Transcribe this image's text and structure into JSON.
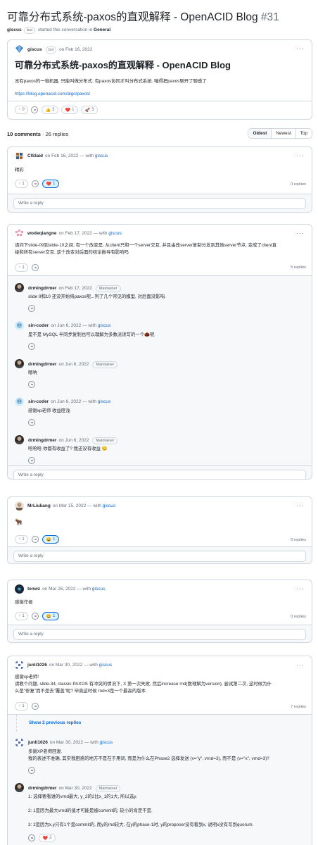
{
  "header": {
    "title": "可靠分布式系统-paxos的直观解释 - OpenACID Blog",
    "number": "#31",
    "author": "giscus",
    "bot_badge": "bot",
    "started_text": "started this conversation in",
    "category": "General"
  },
  "post": {
    "author": "giscus",
    "bot_badge": "bot",
    "date": "on Feb 16, 2022",
    "heading": "可靠分布式系统-paxos的直观解释 - OpenACID Blog",
    "text": "没有paxos的一堆机器, 只能叫做分布式; 有paxos协同才叫分布式系统. 咱得把paxos聊开了聊透了",
    "link": "https://blog.openacid.com/algo/paxos/",
    "reactions": [
      {
        "emoji": "↑",
        "count": "0"
      },
      {
        "emoji": "😄",
        "count": ""
      },
      {
        "emoji": "👍",
        "count": "3"
      },
      {
        "emoji": "❤️",
        "count": "1"
      },
      {
        "emoji": "🚀",
        "count": "3"
      }
    ]
  },
  "comments_summary": {
    "comments": "10 comments",
    "replies": "· 26 replies",
    "sort_options": [
      "Oldest",
      "Newest",
      "Top"
    ]
  },
  "reply_placeholder": "Write a reply",
  "threads": [
    {
      "author": "CISlaid",
      "date": "on Feb 16, 2022 — with",
      "via": "giscus",
      "text": "精彩",
      "upvotes": "1",
      "reaction_emoji": "❤️",
      "reaction_count": "1",
      "replies": "0 replies"
    },
    {
      "author": "wodeqiangne",
      "date": "on Feb 17, 2022 — with",
      "via": "giscus",
      "text_lines": [
        "请问下slide-09到slide-10之间, 有一个改变是, 从client只和一个server交互, 并且由改server复制分发到其他server节点, 变成了client直",
        "接和所有server交互, 这个改变对后面的结论推导有影响吗"
      ],
      "upvotes": "1",
      "replies": "5 replies",
      "replies_list": [
        {
          "author": "drmingdrmer",
          "date": "on Feb 17, 2022",
          "badge": "Maintainer",
          "text": "slide 9和10 还没开始将paxos呢...列了几个常见的模型, 对后面没影响."
        },
        {
          "author": "sin-coder",
          "date": "on Jun 6, 2022 — with",
          "via": "giscus",
          "text": "是不是 MySQL 半同步复制也可以理解为多数派读写的一个🌰呢"
        },
        {
          "author": "drmingdrmer",
          "date": "on Jun 6, 2022",
          "badge": "Maintainer",
          "text": "嗯呐"
        },
        {
          "author": "sin-coder",
          "date": "on Jun 6, 2022 — with",
          "via": "giscus",
          "text": "感谢xp老师 收益匪浅"
        },
        {
          "author": "drmingdrmer",
          "date": "on Jun 6, 2022",
          "badge": "Maintainer",
          "text": "哈哈哈 你都有收益了? 我还没有收益 😔"
        }
      ]
    },
    {
      "author": "MrLiukang",
      "date": "on Mar 15, 2022 — with",
      "via": "giscus",
      "text": "🐂",
      "upvotes": "1",
      "reaction_emoji": "😄",
      "reaction_count": "1",
      "replies": "0 replies"
    },
    {
      "author": "tenwz",
      "date": "on Mar 26, 2022 — with",
      "via": "giscus",
      "text": "感谢作者",
      "upvotes": "1",
      "reaction_emoji": "😄",
      "reaction_count": "1",
      "replies": "0 replies"
    },
    {
      "author": "junli1026",
      "date": "on Mar 30, 2022 — with",
      "via": "giscus",
      "text_lines": [
        "感谢xp老师!",
        "请教个问题, slide-34, classic PAXOS 有冲突的情况下, X 第一次失败, 然后increase rnd(数理解为version), 尝试第二次, 这时候为什",
        "么是\"修复\"而不是去\"覆盖\"呢? 毕竟这时候 rnd=3是一个最高的版本."
      ],
      "upvotes": "1",
      "replies": "7 replies",
      "show_previous": "Show 2 previous replies",
      "replies_list": [
        {
          "author": "junli1026",
          "date": "on Mar 30, 2022 — with",
          "via": "giscus",
          "text_lines": [
            "多谢XP老师回复.",
            "我的表述不准确, 其实我困惑的地方不是在于用词, 而是为什么在Phase2 选择发送 (v=\"y\", vrnd=3), 而不是   (v=\"x\", vrnd=3)?"
          ]
        },
        {
          "author": "drmingdrmer",
          "date": "on Mar 30, 2022",
          "badge": "Maintainer",
          "text_lines": [
            "1: 选择要看谁的vrnd最大, y_2的2比x_1的1大, 所以选y.",
            "",
            "2: 1是因为最大vrnd的值才可能是被commit的, 较小的肯定不是.",
            "",
            "3: 2是因为x,y只有1个是commit的, 而y的rnd较大, 在y的phase-1时, y的proposer没有看到x, 说明x没有写到quorum."
          ],
          "reaction_emoji": "❤️",
          "reaction_count": "2"
        }
      ]
    }
  ]
}
